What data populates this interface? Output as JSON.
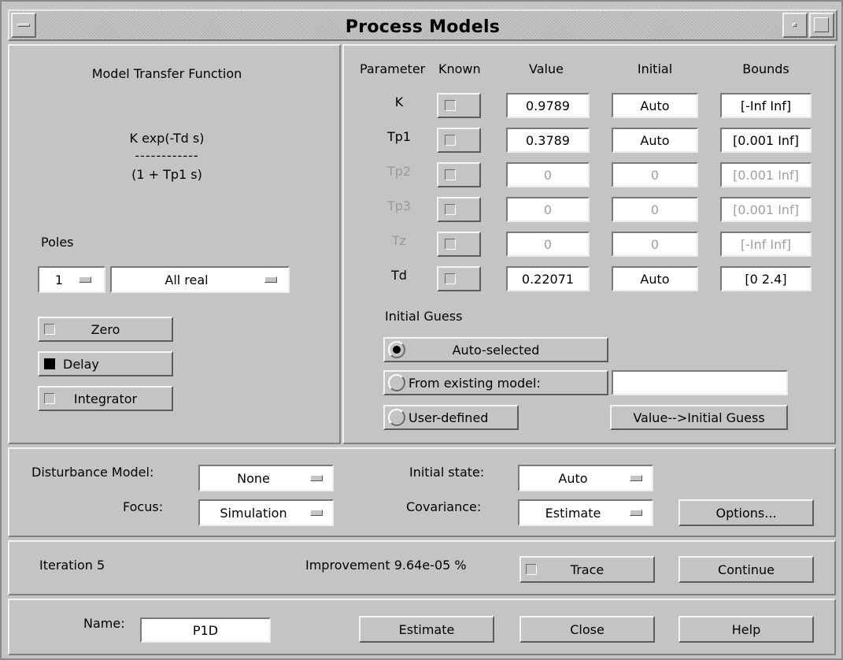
{
  "window": {
    "title": "Process Models"
  },
  "model_panel": {
    "title": "Model Transfer Function",
    "numerator": "K exp(-Td s)",
    "fraction_bar": "------------",
    "denominator": "(1 + Tp1 s)",
    "poles_label": "Poles",
    "poles_count": "1",
    "poles_type": "All real",
    "zero_label": "Zero",
    "delay_label": "Delay",
    "integrator_label": "Integrator",
    "zero_checked": false,
    "delay_checked": true,
    "integrator_checked": false
  },
  "params": {
    "headers": {
      "parameter": "Parameter",
      "known": "Known",
      "value": "Value",
      "initial": "Initial",
      "bounds": "Bounds"
    },
    "rows": [
      {
        "name": "K",
        "value": "0.9789",
        "initial": "Auto",
        "bounds": "[-Inf Inf]",
        "enabled": true
      },
      {
        "name": "Tp1",
        "value": "0.3789",
        "initial": "Auto",
        "bounds": "[0.001 Inf]",
        "enabled": true
      },
      {
        "name": "Tp2",
        "value": "0",
        "initial": "0",
        "bounds": "[0.001 Inf]",
        "enabled": false
      },
      {
        "name": "Tp3",
        "value": "0",
        "initial": "0",
        "bounds": "[0.001 Inf]",
        "enabled": false
      },
      {
        "name": "Tz",
        "value": "0",
        "initial": "0",
        "bounds": "[-Inf Inf]",
        "enabled": false
      },
      {
        "name": "Td",
        "value": "0.22071",
        "initial": "Auto",
        "bounds": "[0 2.4]",
        "enabled": true
      }
    ]
  },
  "initial_guess": {
    "label": "Initial Guess",
    "auto_selected": "Auto-selected",
    "from_existing": "From existing model:",
    "from_existing_value": "",
    "user_defined": "User-defined",
    "value_to_initial": "Value-->Initial Guess",
    "selected": "auto"
  },
  "options": {
    "disturbance_label": "Disturbance Model:",
    "disturbance_value": "None",
    "focus_label": "Focus:",
    "focus_value": "Simulation",
    "initial_state_label": "Initial state:",
    "initial_state_value": "Auto",
    "covariance_label": "Covariance:",
    "covariance_value": "Estimate",
    "options_button": "Options..."
  },
  "status": {
    "iteration": "Iteration 5",
    "improvement": "Improvement 9.64e-05 %",
    "trace_label": "Trace",
    "continue_label": "Continue"
  },
  "footer": {
    "name_label": "Name:",
    "name_value": "P1D",
    "estimate_label": "Estimate",
    "close_label": "Close",
    "help_label": "Help"
  }
}
